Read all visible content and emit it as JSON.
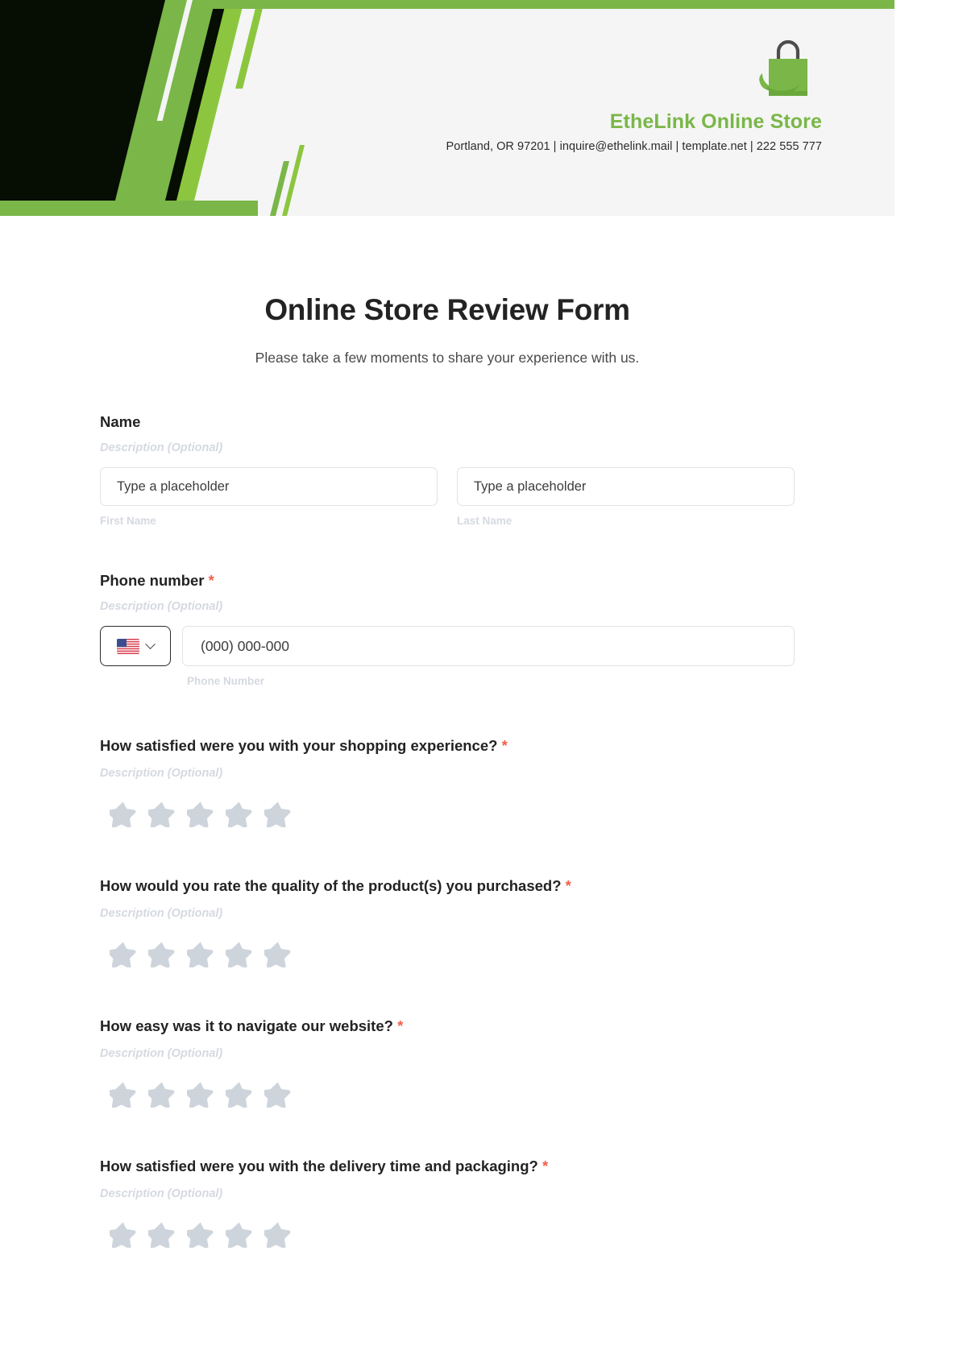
{
  "brand": {
    "name": "EtheLink Online Store",
    "contact": "Portland, OR 97201 | inquire@ethelink.mail | template.net | 222 555 777",
    "logo_icon": "shopping-bag-icon",
    "accent_color": "#7ab648",
    "dark_color": "#060d03"
  },
  "form": {
    "title": "Online Store Review Form",
    "subtitle": "Please take a few moments to share your experience with us.",
    "required_marker": "*",
    "description_placeholder": "Description (Optional)",
    "name_field": {
      "label": "Name",
      "description": "Description (Optional)",
      "first": {
        "placeholder": "Type a placeholder",
        "value": "",
        "sub_label": "First Name"
      },
      "last": {
        "placeholder": "Type a placeholder",
        "value": "",
        "sub_label": "Last Name"
      }
    },
    "phone_field": {
      "label": "Phone number",
      "required": true,
      "description": "Description (Optional)",
      "country_flag": "us-flag-icon",
      "country_code": "US",
      "placeholder": "(000) 000-000",
      "value": "",
      "sub_label": "Phone Number"
    },
    "ratings": [
      {
        "question": "How satisfied were you with your shopping experience?",
        "required": true,
        "description": "Description (Optional)",
        "max_stars": 5,
        "selected": 0
      },
      {
        "question": "How would you rate the quality of the product(s) you purchased?",
        "required": true,
        "description": "Description (Optional)",
        "max_stars": 5,
        "selected": 0
      },
      {
        "question": "How easy was it to navigate our website?",
        "required": true,
        "description": "Description (Optional)",
        "max_stars": 5,
        "selected": 0
      },
      {
        "question": "How satisfied were you with the delivery time and packaging?",
        "required": true,
        "description": "Description (Optional)",
        "max_stars": 5,
        "selected": 0
      }
    ]
  },
  "colors": {
    "star_empty": "#ced4db",
    "required_red": "#f2604c",
    "muted_label": "#d5d9e0"
  }
}
